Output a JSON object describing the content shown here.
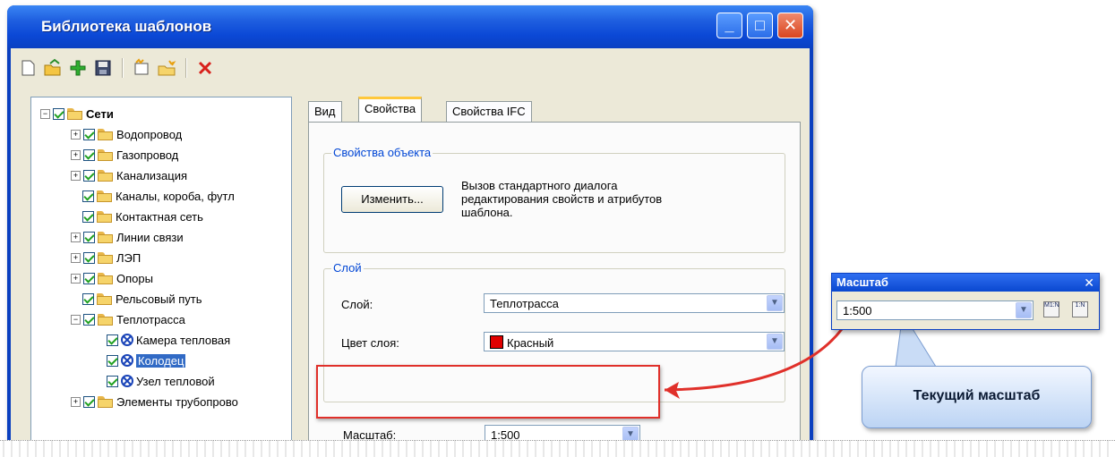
{
  "window": {
    "title": "Библиотека шаблонов"
  },
  "toolbar": {
    "icons": [
      "new-file-icon",
      "open-icon",
      "add-icon",
      "save-icon",
      "new-template-icon",
      "new-folder-icon",
      "delete-icon"
    ]
  },
  "tree": {
    "root": "Сети",
    "items": [
      "Водопровод",
      "Газопровод",
      "Канализация",
      "Каналы, короба, футл",
      "Контактная сеть",
      "Линии связи",
      "ЛЭП",
      "Опоры",
      "Рельсовый путь",
      "Теплотрасса"
    ],
    "children": [
      "Камера тепловая",
      "Колодец",
      "Узел тепловой"
    ],
    "last": "Элементы трубопрово"
  },
  "tabs": [
    "Вид",
    "Свойства",
    "Свойства IFC"
  ],
  "object_props": {
    "legend": "Свойства объекта",
    "edit_button": "Изменить...",
    "description": [
      "Вызов стандартного диалога",
      "редактирования свойств и атрибутов",
      "шаблона."
    ]
  },
  "layer": {
    "legend": "Слой",
    "layer_label": "Слой:",
    "layer_value": "Теплотрасса",
    "color_label": "Цвет слоя:",
    "color_value": "Красный",
    "color_hex": "#e00000"
  },
  "scale": {
    "label": "Масштаб:",
    "value": "1:500"
  },
  "scale_toolbar": {
    "title": "Масштаб",
    "value": "1:500",
    "close": "✕",
    "btn1": "M1:N",
    "btn2": "1:N"
  },
  "callout": {
    "text": "Текущий масштаб"
  },
  "colors": {
    "highlight": "#e0302a",
    "title_blue": "#0a48d0",
    "group_legend": "#0046d5"
  }
}
